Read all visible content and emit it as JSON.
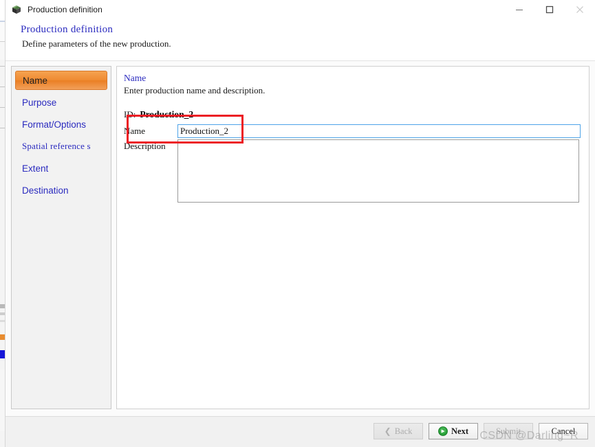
{
  "window": {
    "title": "Production definition",
    "icon": "cube-icon",
    "controls": {
      "minimize": "minimize-icon",
      "maximize": "maximize-icon",
      "close": "close-icon"
    }
  },
  "header": {
    "title": "Production definition",
    "subtitle": "Define parameters of the new production."
  },
  "sidebar": {
    "items": [
      {
        "label": "Name",
        "selected": true
      },
      {
        "label": "Purpose",
        "selected": false
      },
      {
        "label": "Format/Options",
        "selected": false
      },
      {
        "label": "Spatial reference s",
        "selected": false
      },
      {
        "label": "Extent",
        "selected": false
      },
      {
        "label": "Destination",
        "selected": false
      }
    ]
  },
  "content": {
    "title": "Name",
    "subtitle": "Enter production name and description.",
    "id_label": "ID:",
    "id_value": "Production_2",
    "name_label": "Name",
    "name_value": "Production_2",
    "name_placeholder": "",
    "description_label": "Description",
    "description_value": "",
    "description_placeholder": ""
  },
  "footer": {
    "buttons": [
      {
        "label": "Back",
        "icon": "chevron-left-icon",
        "disabled": true
      },
      {
        "label": "Next",
        "icon": "green-arrow-right-icon",
        "disabled": false,
        "primary": true
      },
      {
        "label": "Submit",
        "icon": "",
        "disabled": true
      },
      {
        "label": "Cancel",
        "icon": "",
        "disabled": false
      }
    ]
  },
  "watermark": {
    "text": "CSDN @Darling~R"
  },
  "colors": {
    "accent_selected": "#ea7f24",
    "link_blue": "#2b2bbf",
    "focus_border": "#4da3e8",
    "annotation_red": "#ec1c24",
    "next_icon_green": "#1f9d2f"
  }
}
